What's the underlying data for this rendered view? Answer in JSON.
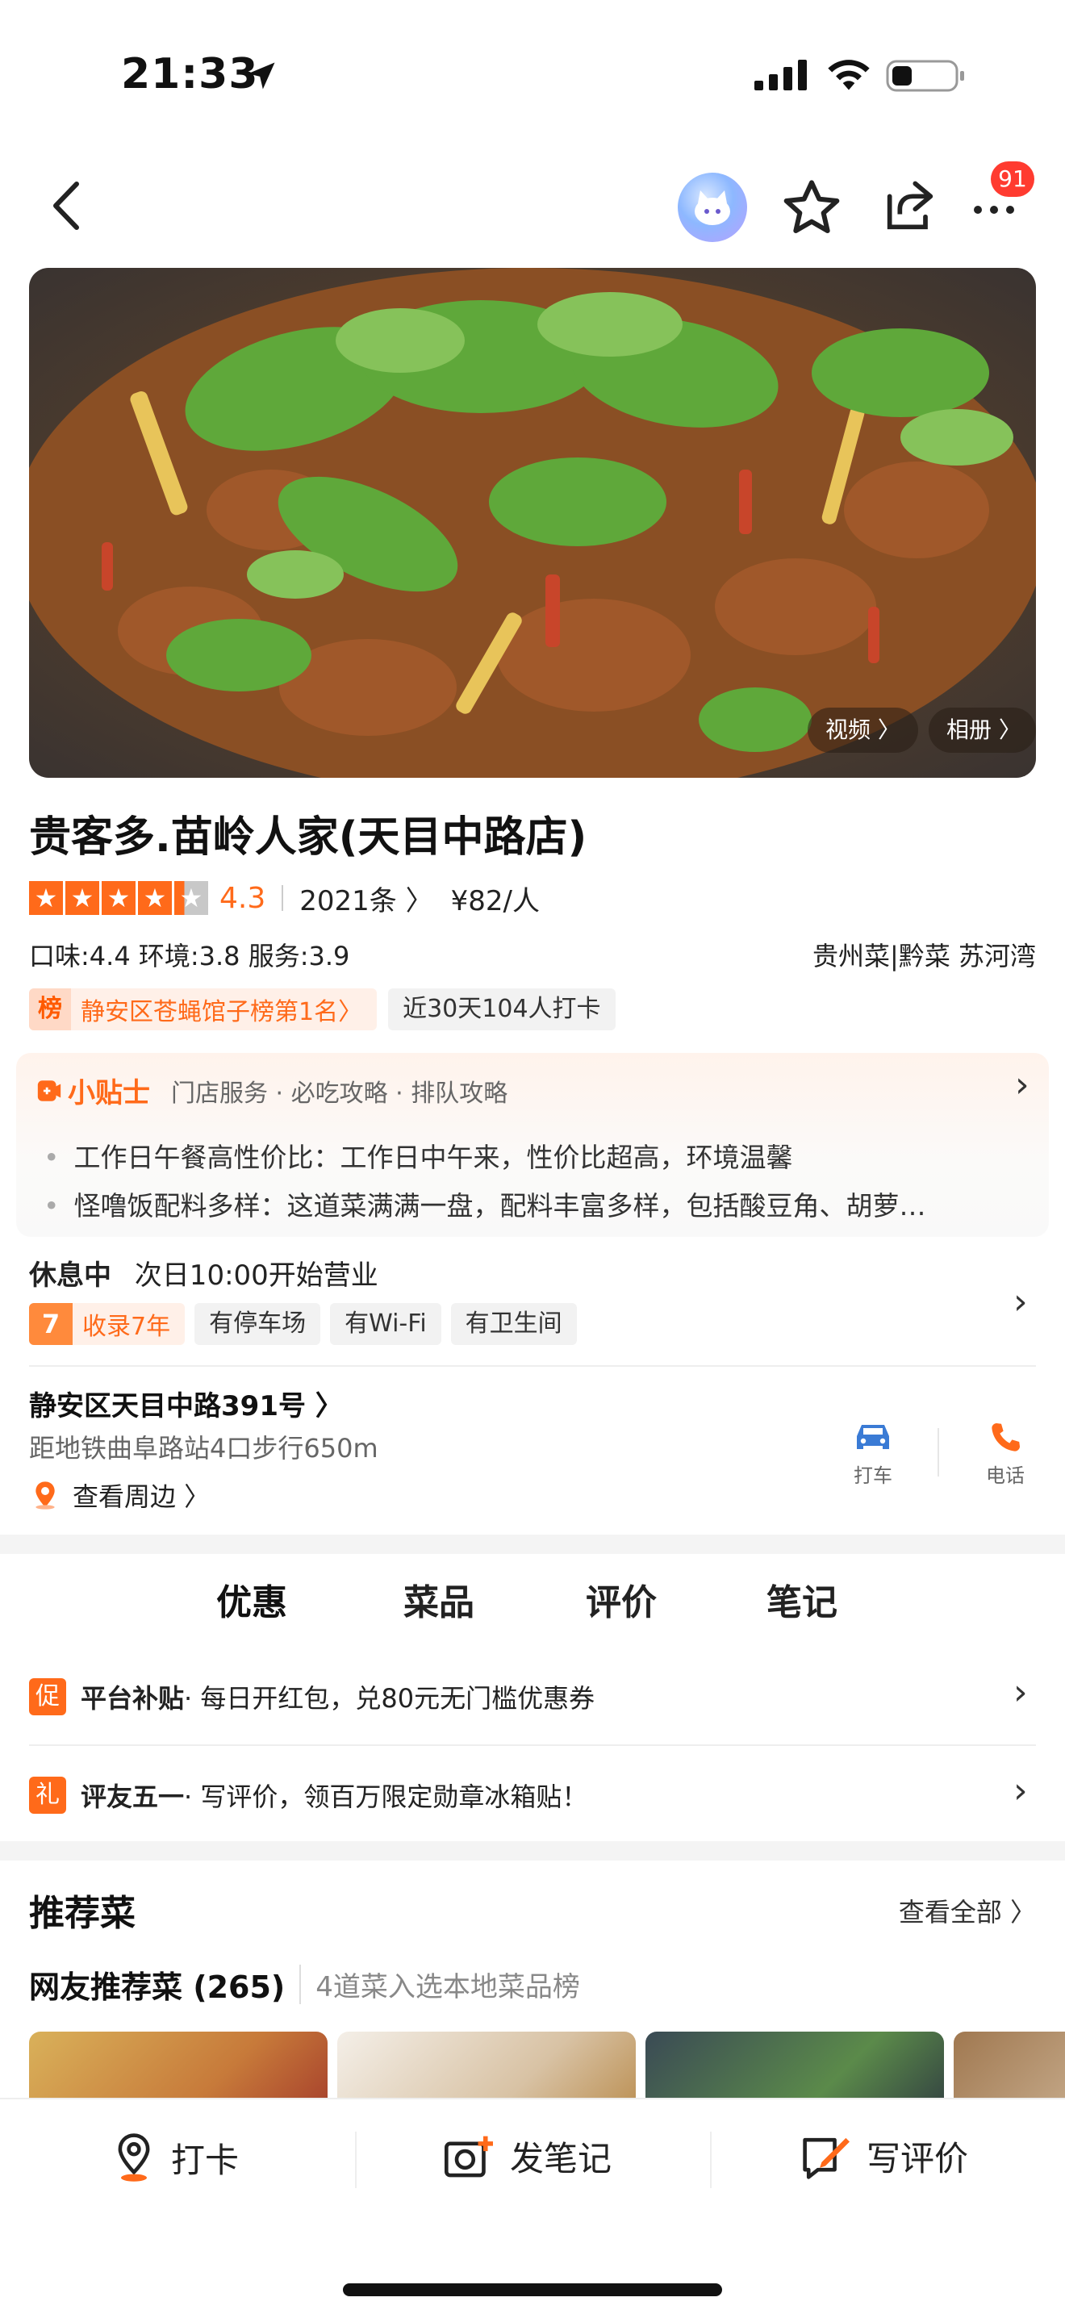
{
  "status_bar": {
    "time": "21:33"
  },
  "nav": {
    "badge_count": "91"
  },
  "hero": {
    "video_label": "视频 〉",
    "album_label": "相册 〉"
  },
  "shop": {
    "name": "贵客多.苗岭人家(天目中路店)",
    "rating": 4.3,
    "score_text": "4.3",
    "reviews": "2021条 〉",
    "price": "¥82/人",
    "subscores": "口味:4.4  环境:3.8  服务:3.9",
    "cuisine": "贵州菜|黔菜   苏河湾",
    "rank_icon": "榜",
    "rank_label": "静安区苍蝇馆子榜第1名〉",
    "checkin_label": "近30天104人打卡"
  },
  "tips": {
    "brand": "小贴士",
    "categories": "门店服务 · 必吃攻略 · 排队攻略",
    "items": [
      "工作日午餐高性价比：工作日中午来，性价比超高，环境温馨",
      "怪噜饭配料多样：这道菜满满一盘，配料丰富多样，包括酸豆角、胡萝…"
    ]
  },
  "hours": {
    "status": "休息中",
    "next": "次日10:00开始营业"
  },
  "facility_tags": {
    "year_icon": "7",
    "year_label": "收录7年",
    "items": [
      "有停车场",
      "有Wi-Fi",
      "有卫生间"
    ]
  },
  "location": {
    "address": "静安区天目中路391号 〉",
    "distance": "距地铁曲阜路站4口步行650m",
    "nearby": "查看周边 〉",
    "taxi_label": "打车",
    "phone_label": "电话"
  },
  "tabs": [
    "优惠",
    "菜品",
    "评价",
    "笔记"
  ],
  "promos": [
    {
      "icon": "促",
      "title": "平台补贴",
      "text": " · 每日开红包，兑80元无门槛优惠券"
    },
    {
      "icon": "礼",
      "title": "评友五一",
      "text": " · 写评价，领百万限定勋章冰箱贴！"
    }
  ],
  "recommend": {
    "title": "推荐菜",
    "view_all": "查看全部 〉",
    "sub_title": "网友推荐菜 (265)",
    "sub_note": "4道菜入选本地菜品榜"
  },
  "bottom_bar": {
    "checkin": "打卡",
    "note": "发笔记",
    "review": "写评价"
  },
  "colors": {
    "accent": "#ff6a1a",
    "badge": "#ff3b30",
    "taxi": "#3a7bd5"
  }
}
